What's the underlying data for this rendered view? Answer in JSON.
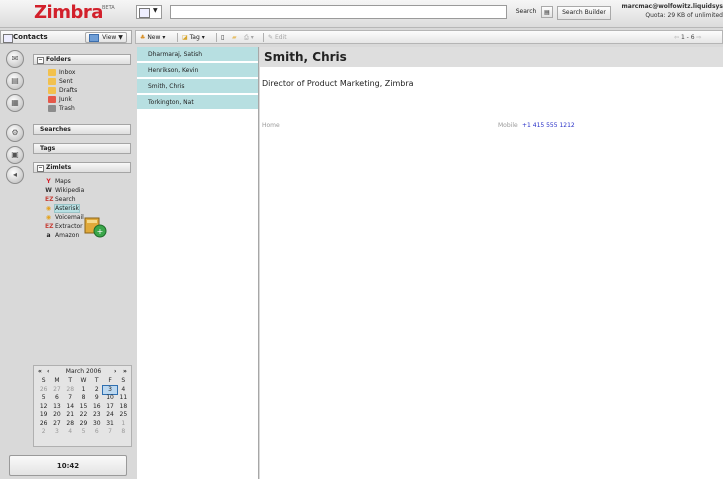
{
  "brand": {
    "logo": "Zimbra",
    "beta": "BETA"
  },
  "topbar": {
    "search_type_icon": "contacts-icon",
    "search_value": "",
    "search_label": "Search",
    "search_builder_label": "Search Builder",
    "account_email": "marcmac@wolfowitz.liquidsys",
    "quota": "Quota: 29 KB of unlimited"
  },
  "app": {
    "title": "Contacts",
    "view_label": "View"
  },
  "app_icons": [
    "mail-icon",
    "contacts-icon",
    "calendar-icon",
    "options-icon",
    "notebook-icon",
    "tasks-icon"
  ],
  "overview": {
    "folders_label": "Folders",
    "folders": [
      {
        "label": "Inbox",
        "icon": "inbox-icon",
        "color": "#f2c14e"
      },
      {
        "label": "Sent",
        "icon": "sent-icon",
        "color": "#f2c14e"
      },
      {
        "label": "Drafts",
        "icon": "drafts-icon",
        "color": "#f2c14e"
      },
      {
        "label": "Junk",
        "icon": "junk-icon",
        "color": "#e5584a"
      },
      {
        "label": "Trash",
        "icon": "trash-icon",
        "color": "#8c8c8c"
      }
    ],
    "searches_label": "Searches",
    "tags_label": "Tags",
    "zimlets_label": "Zimlets",
    "zimlets": [
      {
        "label": "Maps",
        "glyph": "Y",
        "color": "#d2202b"
      },
      {
        "label": "Wikipedia",
        "glyph": "W",
        "color": "#333333"
      },
      {
        "label": "Search",
        "glyph": "EZ",
        "color": "#c6423a"
      },
      {
        "label": "Asterisk",
        "glyph": "◉",
        "color": "#e3a321"
      },
      {
        "label": "Voicemail",
        "glyph": "◉",
        "color": "#e3a321"
      },
      {
        "label": "Extractor",
        "glyph": "EZ",
        "color": "#c6423a"
      },
      {
        "label": "Amazon",
        "glyph": "a",
        "color": "#222222"
      }
    ]
  },
  "calendar": {
    "month": "March 2006",
    "day_headers": [
      "S",
      "M",
      "T",
      "W",
      "T",
      "F",
      "S"
    ],
    "weeks": [
      [
        "26",
        "27",
        "28",
        "1",
        "2",
        "3",
        "4"
      ],
      [
        "5",
        "6",
        "7",
        "8",
        "9",
        "10",
        "11"
      ],
      [
        "12",
        "13",
        "14",
        "15",
        "16",
        "17",
        "18"
      ],
      [
        "19",
        "20",
        "21",
        "22",
        "23",
        "24",
        "25"
      ],
      [
        "26",
        "27",
        "28",
        "29",
        "30",
        "31",
        "1"
      ],
      [
        "2",
        "3",
        "4",
        "5",
        "6",
        "7",
        "8"
      ]
    ],
    "today": "3"
  },
  "clock": "10:42",
  "toolbar": {
    "new_label": "New",
    "tag_label": "Tag",
    "edit_label": "Edit",
    "page_info": "1 - 6"
  },
  "contacts": [
    "Dharmaraj, Satish",
    "Henrikson, Kevin",
    "Smith, Chris",
    "Torkington, Nat"
  ],
  "detail": {
    "name": "Smith, Chris",
    "title": "Director of Product Marketing, Zimbra",
    "home_label": "Home",
    "mobile_label": "Mobile",
    "mobile_number": "+1 415 555 1212"
  }
}
